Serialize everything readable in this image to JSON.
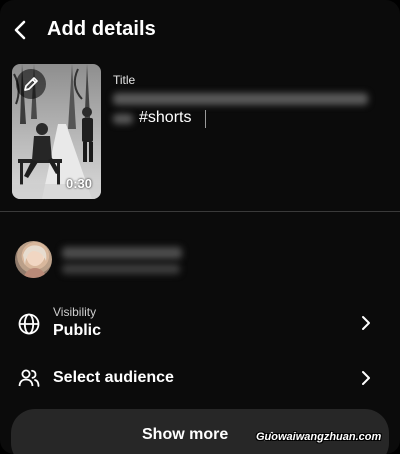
{
  "header": {
    "title": "Add details"
  },
  "thumbnail": {
    "duration": "0:30"
  },
  "title_field": {
    "label": "Title",
    "visible_text": "#shorts"
  },
  "visibility": {
    "label": "Visibility",
    "value": "Public"
  },
  "audience": {
    "label": "Select audience"
  },
  "show_more": {
    "label": "Show more"
  },
  "watermark": {
    "text": "Guowaiwangzhuan.com"
  },
  "colors": {
    "background": "#0b0b0b",
    "button_bg": "#272727",
    "divider": "#3a3a3a"
  }
}
